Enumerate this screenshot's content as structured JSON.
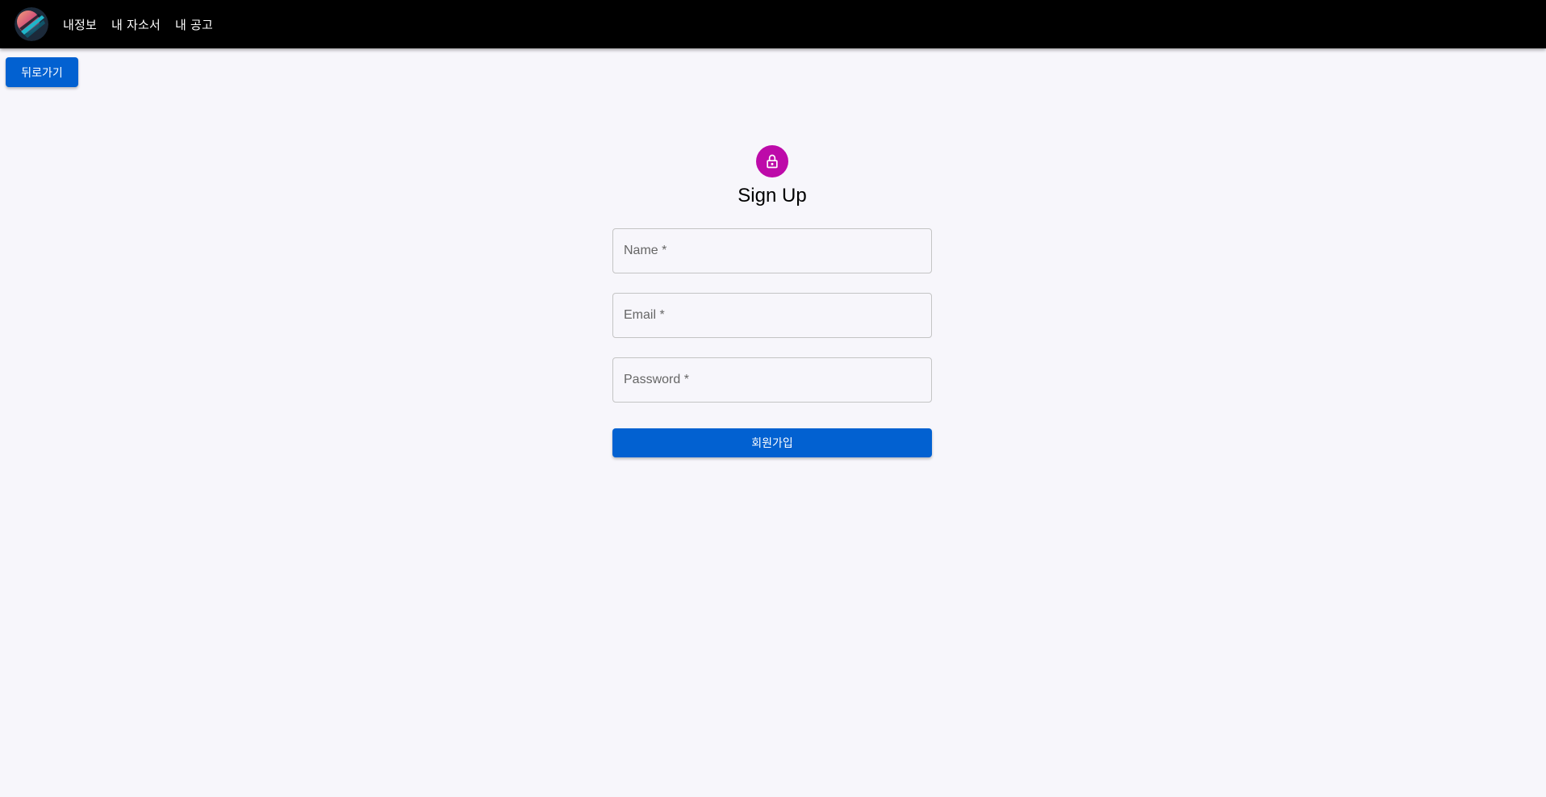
{
  "navbar": {
    "logo_icon": "logo-icon",
    "links": [
      {
        "label": "내정보"
      },
      {
        "label": "내 자소서"
      },
      {
        "label": "내 공고"
      }
    ]
  },
  "back_button": {
    "label": "뒤로가기"
  },
  "signup": {
    "icon": "lock-icon",
    "title": "Sign Up",
    "fields": {
      "name": {
        "placeholder": "Name *",
        "value": ""
      },
      "email": {
        "placeholder": "Email *",
        "value": ""
      },
      "password": {
        "placeholder": "Password *",
        "value": ""
      }
    },
    "submit_label": "회원가입"
  },
  "colors": {
    "navbar_bg": "#000000",
    "page_bg": "#f7f6fb",
    "primary": "#0261d1",
    "avatar": "#bd0aa9"
  }
}
